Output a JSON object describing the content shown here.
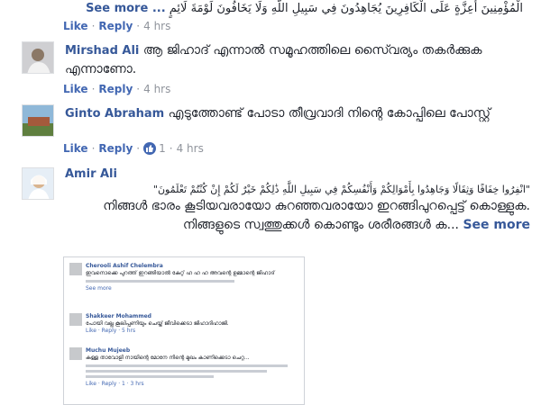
{
  "top_comment": {
    "text": "الْمُؤْمِنِينَ أَعِزَّةٍ عَلَى الْكَافِرِينَ يُجَاهِدُونَ فِي سَبِيلِ اللَّهِ وَلَا يَخَافُونَ لَوْمَةَ لَائِمٍ",
    "see_more": "See more ...",
    "like": "Like",
    "reply": "Reply",
    "time": "4 hrs"
  },
  "comments": [
    {
      "author": "Mirshad Ali",
      "text": "ആ ജിഹാദ് എന്നാൽ സമൂഹത്തിലെ സൈ്വര്യം തകർക്കുക എന്നാണോ.",
      "like": "Like",
      "reply": "Reply",
      "time": "4 hrs"
    },
    {
      "author": "Ginto Abraham",
      "text": "എടുത്തോണ്ട് പോടാ തീവ്രവാദി നിന്റെ കോപ്പിലെ പോസ്റ്റ്",
      "like": "Like",
      "reply": "Reply",
      "like_count": "1",
      "time": "4 hrs"
    },
    {
      "author": "Amir Ali",
      "arabic": "\"انْفِرُوا خِفَافًا وَثِقَالًا وَجَاهِدُوا بِأَمْوَالِكُمْ وَأَنْفُسِكُمْ فِي سَبِيلِ اللَّهِ ذَٰلِكُمْ خَيْرٌ لَكُمْ إِنْ كُنْتُمْ تَعْلَمُونَ\"",
      "text": "നിങ്ങൾ ഭാരം കൂടിയവരായോ കുറഞ്ഞവരായോ ഇറങ്ങിപുറപ്പെട്ട് കൊള്ളുക. നിങ്ങളുടെ സ്വത്തുക്കൾ കൊണ്ടും ശരീരങ്ങൾ ക...",
      "see_more": "See more"
    }
  ],
  "embedded_screenshot": {
    "comments": [
      {
        "author": "Cherooli Ashif Chelembra",
        "text": "ഇവനൊക്കെ പുറത്ത് ഇറങ്ങിയാൽ കേറ്റ് ഹ ഹ ഹ അവന്റെ ഉമ്മാന്റെ ജിഹാദ്",
        "see_more": "See more"
      },
      {
        "author": "Shakkeer Mohammed",
        "text": "പോയി വല്ല കൂലിപ്പണിയും ചെയ്ത് ജീവിക്കെടാ ജിഹാദിഹാജി.",
        "actions": "Like · Reply · 5 hrs"
      },
      {
        "author": "Muchu Mujeeb",
        "text": "കള്ള താവോളി നായിന്റെ മോനേ നിന്റെ മുഖം കാണിക്കെടാ ചെറ്റ...",
        "actions": "Like · Reply · 1 · 3 hrs"
      }
    ]
  }
}
